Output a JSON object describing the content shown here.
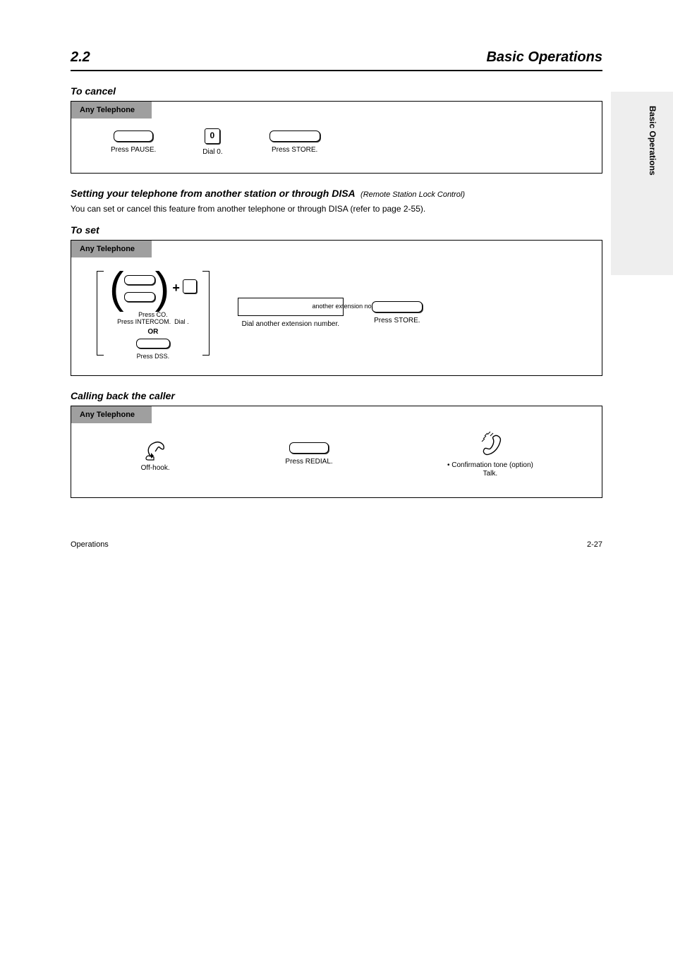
{
  "header": {
    "section_num": "2.2",
    "section_title": "Basic Operations"
  },
  "side_tab": "Basic Operations",
  "block1": {
    "heading": "To cancel",
    "diag_title": "Any Telephone",
    "step1": "Press PAUSE.",
    "step2_key": "0",
    "step2": "Dial 0.",
    "step3": "Press STORE."
  },
  "block2": {
    "heading": "Setting your telephone from another station or through DISA",
    "heading_small": "(Remote Station Lock Control)",
    "body": "You can set or cancel this feature from another telephone or through DISA (refer to page 2-55).",
    "h_set": "To set",
    "diag_title": "Any Telephone",
    "combo": {
      "co": "Press CO.",
      "intercom": "Press INTERCOM.",
      "star": "Dial   .",
      "dss": "Press DSS.",
      "or": "OR"
    },
    "ext_label": "another extension no.",
    "ext_step": "Dial another extension number.",
    "store": "Press STORE."
  },
  "block3": {
    "heading": "Calling back the caller",
    "diag_title": "Any Telephone",
    "step1": "Off-hook.",
    "step2": "Press REDIAL.",
    "step3_a": "• Confirmation tone (option)",
    "step3_b": "Talk."
  },
  "footer": {
    "left": "Operations",
    "right": "2-27"
  }
}
